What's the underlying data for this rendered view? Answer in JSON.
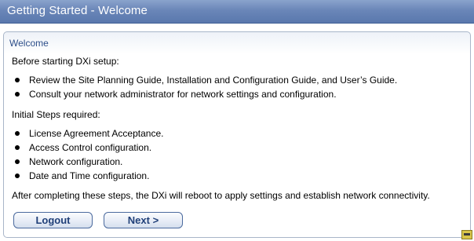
{
  "window": {
    "title": "Getting Started - Welcome"
  },
  "panel": {
    "heading": "Welcome",
    "intro": "Before starting DXi setup:",
    "intro_items": [
      "Review the Site Planning Guide, Installation and Configuration Guide, and User’s Guide.",
      "Consult your network administrator for network settings and configuration."
    ],
    "steps_heading": "Initial Steps required:",
    "steps": [
      "License Agreement Acceptance.",
      "Access Control configuration.",
      "Network configuration.",
      "Date and Time configuration."
    ],
    "footer_note": "After completing these steps, the DXi will reboot to apply settings and establish network connectivity."
  },
  "buttons": {
    "logout": "Logout",
    "next": "Next >"
  },
  "icons": {
    "corner": "resize-grip-icon"
  },
  "colors": {
    "title_bar": "#6a86b8",
    "heading": "#2e4f8a",
    "button_text": "#1f3f78"
  }
}
